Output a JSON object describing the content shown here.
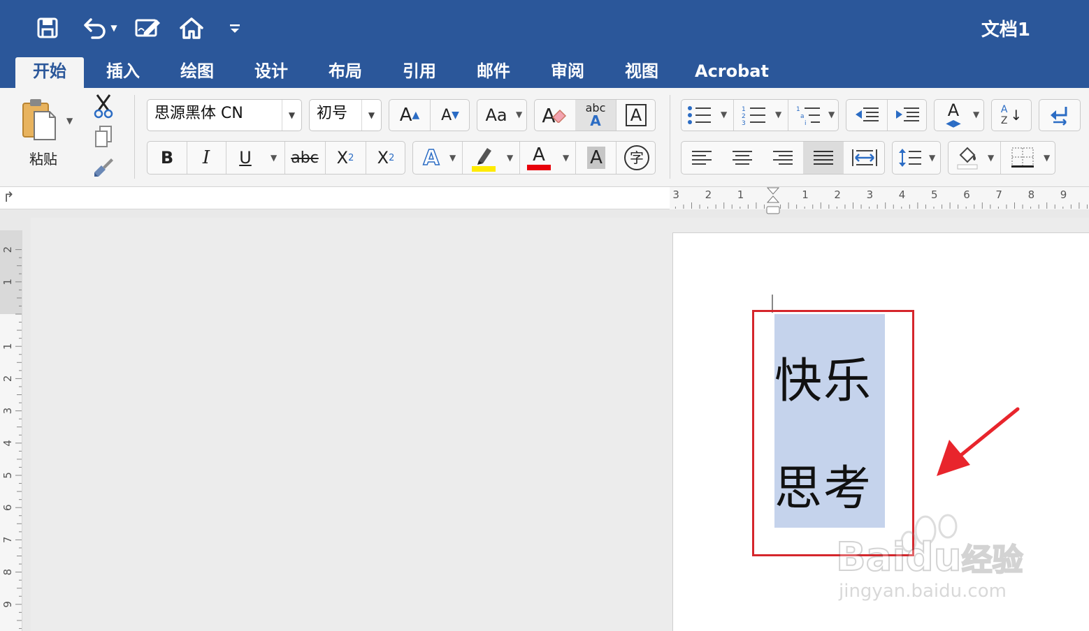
{
  "window": {
    "title": "文档1"
  },
  "quick_access": {
    "save_icon": "save-icon",
    "undo_icon": "undo-icon",
    "edit_icon": "edit-document-icon",
    "home_icon": "home-icon",
    "customize_icon": "customize-toolbar-icon"
  },
  "tabs": [
    {
      "label": "开始",
      "active": true
    },
    {
      "label": "插入"
    },
    {
      "label": "绘图"
    },
    {
      "label": "设计"
    },
    {
      "label": "布局"
    },
    {
      "label": "引用"
    },
    {
      "label": "邮件"
    },
    {
      "label": "审阅"
    },
    {
      "label": "视图"
    },
    {
      "label": "Acrobat"
    }
  ],
  "ribbon": {
    "paste_label": "粘贴",
    "font_name": "思源黑体 CN",
    "font_size": "初号",
    "bold": "B",
    "italic": "I",
    "underline": "U",
    "strikethrough": "abc",
    "change_case": "Aa",
    "char_shading_letter": "A",
    "phonetic_guide": "字",
    "grow_font": "A",
    "shrink_font": "A",
    "text_effects": "A",
    "font_color_letter": "A",
    "clear_format_letter": "A",
    "spell_abc": "abc",
    "spell_letter": "A",
    "char_border_letter": "A",
    "sort_top": "A",
    "sort_bottom": "Z",
    "styles_letter": "A",
    "subscript_base": "X",
    "subscript_suffix": "2",
    "superscript_base": "X",
    "superscript_suffix": "2"
  },
  "colors": {
    "accent": "#2b579a",
    "highlight_yellow": "#ffeb00",
    "font_red": "#e8000b",
    "selection": "#c5d3ec",
    "annotation_red": "#d5262c"
  },
  "ruler": {
    "h_left": [
      "3",
      "2",
      "1"
    ],
    "h_right": [
      "1",
      "2",
      "3",
      "4",
      "5",
      "6",
      "7",
      "8",
      "9"
    ],
    "v_top": [
      "2",
      "1"
    ],
    "v_main": [
      "1",
      "2",
      "3",
      "4",
      "5",
      "6",
      "7",
      "8",
      "9"
    ]
  },
  "document": {
    "lines": [
      "快乐",
      "思考"
    ]
  },
  "watermark": {
    "brand": "Baidu",
    "suffix": "经验",
    "url": "jingyan.baidu.com"
  }
}
